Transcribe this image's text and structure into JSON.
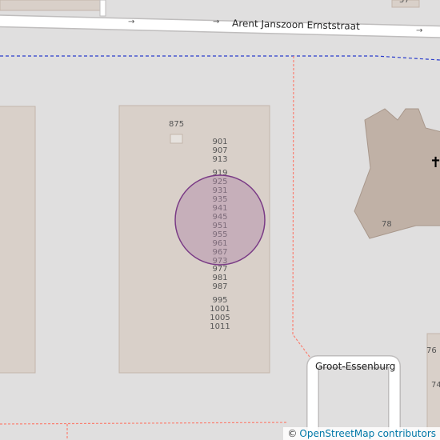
{
  "streets": {
    "main": "Arent Janszoon Ernststraat",
    "side": "Groot-Essenburg"
  },
  "buildings": {
    "block_small": "875",
    "block_numbers": [
      "901",
      "907",
      "913",
      "919",
      "925",
      "931",
      "935",
      "941",
      "945",
      "951",
      "955",
      "961",
      "967",
      "973",
      "977",
      "981",
      "987",
      "995",
      "1001",
      "1005",
      "1011"
    ],
    "church_number": "78",
    "east_numbers": [
      "76",
      "74"
    ],
    "top_right_number": "57"
  },
  "icons": {
    "church": "✝",
    "direction": "→"
  },
  "attribution": {
    "symbol": "©",
    "text": "OpenStreetMap contributors"
  },
  "colors": {
    "background": "#e0dfdf",
    "building": "#d9d0c9",
    "building_outline": "#c4b6ab",
    "church": "#c0b1a6",
    "road": "#ffffff",
    "road_casing": "#bfbdbd",
    "boundary_blue": "#2b3ccc",
    "footway_red": "#fa8072",
    "marker_fill": "#b088a8",
    "marker_stroke": "#7a3b86"
  }
}
